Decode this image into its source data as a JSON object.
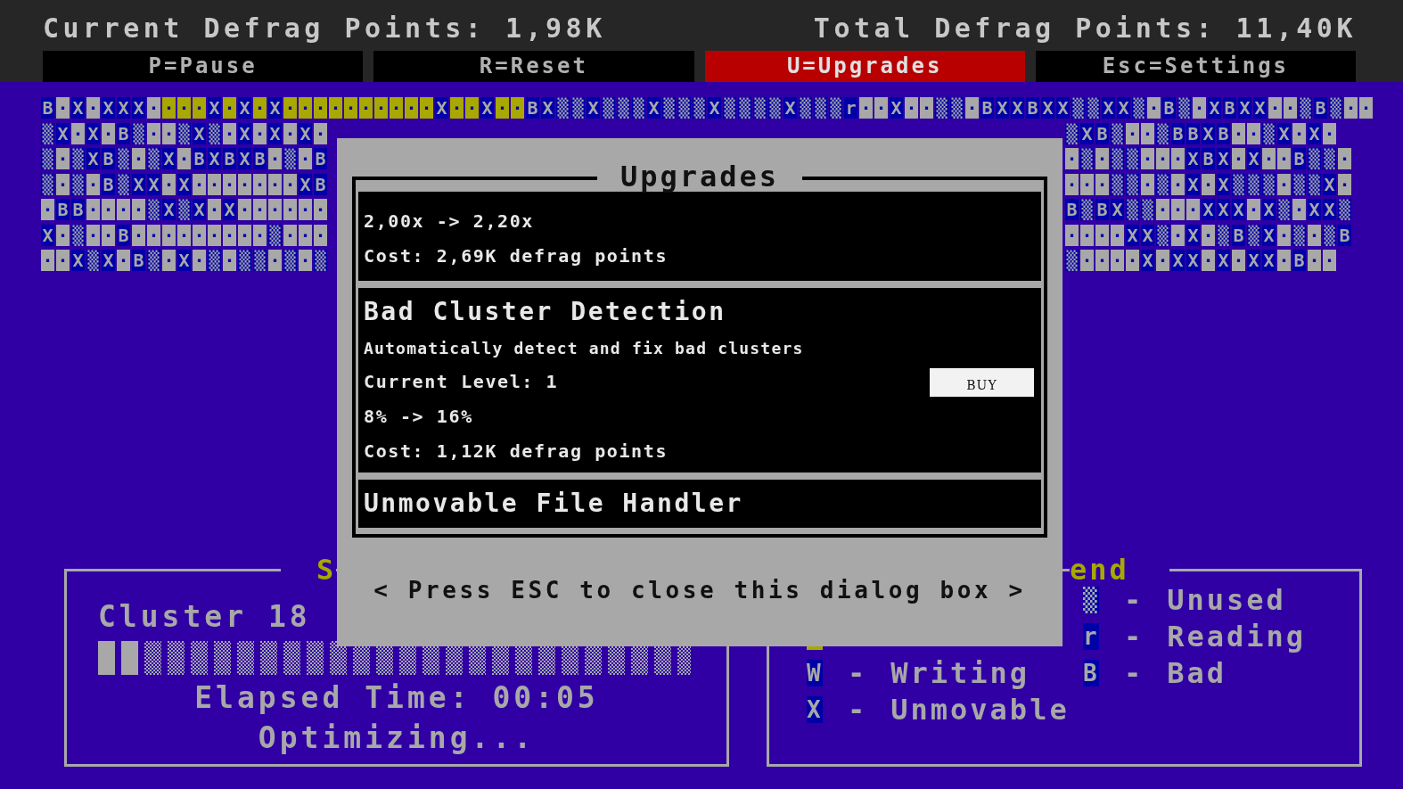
{
  "header": {
    "current_points": "Current Defrag Points: 1,98K",
    "total_points": "Total Defrag Points: 11,40K"
  },
  "tabs": [
    {
      "label": "P=Pause",
      "selected": false
    },
    {
      "label": "R=Reset",
      "selected": false
    },
    {
      "label": "U=Upgrades",
      "selected": true
    },
    {
      "label": "Esc=Settings",
      "selected": false
    }
  ],
  "cluster_map": {
    "rows": [
      {
        "left": [
          {
            "cells": "B·X·XXX·",
            "optimized": false
          },
          {
            "cells": "···",
            "optimized": true
          },
          {
            "cells": "X",
            "optimized": false
          },
          {
            "cells": "·",
            "optimized": true
          },
          {
            "cells": "X",
            "optimized": false
          },
          {
            "cells": "·",
            "optimized": true
          },
          {
            "cells": "X",
            "optimized": false
          },
          {
            "cells": "··········",
            "optimized": true
          },
          {
            "cells": "X",
            "optimized": false
          },
          {
            "cells": "··",
            "optimized": true
          },
          {
            "cells": "X",
            "optimized": false
          },
          {
            "cells": "··",
            "optimized": true
          },
          {
            "cells": "BX▒▒X▒▒▒X▒▒▒X▒▒▒▒X▒▒▒r··X··▒▒·BXXBXX▒▒XX▒·B▒·XBXX··▒B▒··",
            "optimized": false
          }
        ]
      },
      {
        "left": [
          {
            "cells": "▒X·X·B▒··▒X▒·X·X·X·",
            "optimized": false
          }
        ],
        "right": [
          {
            "cells": "▒XB▒··▒BBXB··▒X·X·",
            "optimized": false
          }
        ]
      },
      {
        "left": [
          {
            "cells": "▒·▒XB▒·▒X·BXBXB·▒·B",
            "optimized": false
          }
        ],
        "right": [
          {
            "cells": "·▒·▒▒···XBX·X··B▒▒·",
            "optimized": false
          }
        ]
      },
      {
        "left": [
          {
            "cells": "▒·▒·B▒XX·X·······XB",
            "optimized": false
          }
        ],
        "right": [
          {
            "cells": "···▒▒·▒·X·X▒▒▒·▒▒X·",
            "optimized": false
          }
        ]
      },
      {
        "left": [
          {
            "cells": "·BB····▒X▒X·X······",
            "optimized": false
          }
        ],
        "right": [
          {
            "cells": "B▒BX▒▒···XXX·X▒·XX▒",
            "optimized": false
          }
        ]
      },
      {
        "left": [
          {
            "cells": "X·▒··B·········▒···",
            "optimized": false
          }
        ],
        "right": [
          {
            "cells": "····XX▒·X·▒B▒X·▒·▒B",
            "optimized": false
          }
        ]
      },
      {
        "left": [
          {
            "cells": "··X▒X·B▒·X·▒·▒▒·▒·▒",
            "optimized": false
          }
        ],
        "right": [
          {
            "cells": "▒····X·XX·X·XX·B··",
            "optimized": false
          }
        ]
      }
    ]
  },
  "status_panel": {
    "title": "S",
    "cluster": "Cluster 18",
    "progress": {
      "level": 0.075
    },
    "elapsed": "Elapsed Time: 00:05",
    "state": "Optimizing..."
  },
  "legend_panel": {
    "title": "end",
    "columns": [
      [
        {
          "kind": "swatch",
          "optimized": true
        },
        {
          "kind": "symbol",
          "symbol": "W",
          "separator": "-",
          "label": "Writing"
        },
        {
          "kind": "symbol",
          "symbol": "X",
          "separator": "-",
          "label": "Unmovable"
        }
      ],
      [
        {
          "kind": "symbol",
          "symbol": "▒",
          "separator": "-",
          "label": "Unused"
        },
        {
          "kind": "symbol",
          "symbol": "r",
          "separator": "-",
          "label": "Reading"
        },
        {
          "kind": "symbol",
          "symbol": "B",
          "separator": "-",
          "label": "Bad"
        }
      ]
    ]
  },
  "dialog": {
    "title": "Upgrades",
    "upgrades": [
      {
        "change": "2,00x -> 2,20x",
        "cost": "Cost: 2,69K defrag points"
      },
      {
        "name": "Bad Cluster Detection",
        "description": "Automatically detect and fix bad clusters",
        "level": "Current Level: 1",
        "button": {
          "label": "BUY",
          "disabled": false
        },
        "change": "8% -> 16%",
        "cost": "Cost: 1,12K defrag points"
      },
      {
        "name": "Unmovable File Handler"
      }
    ],
    "prompt": "< Press ESC to close this dialog box >"
  }
}
